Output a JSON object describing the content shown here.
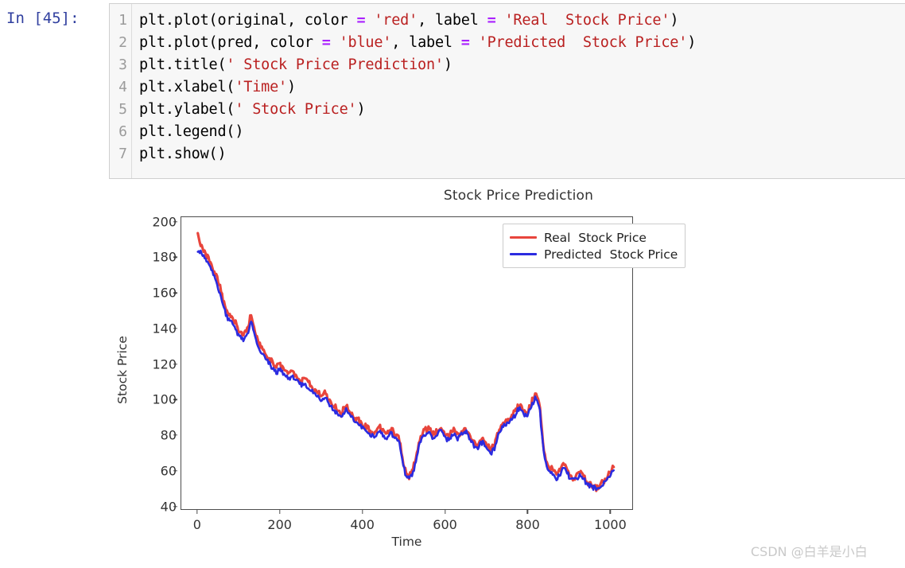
{
  "notebook": {
    "prompt": "In [45]:",
    "line_numbers": [
      "1",
      "2",
      "3",
      "4",
      "5",
      "6",
      "7"
    ],
    "code_lines": [
      [
        {
          "t": "plt.plot(original, color ",
          "c": "plain"
        },
        {
          "t": "=",
          "c": "op"
        },
        {
          "t": " ",
          "c": "plain"
        },
        {
          "t": "'red'",
          "c": "str"
        },
        {
          "t": ", label ",
          "c": "plain"
        },
        {
          "t": "=",
          "c": "op"
        },
        {
          "t": " ",
          "c": "plain"
        },
        {
          "t": "'Real  Stock Price'",
          "c": "str"
        },
        {
          "t": ")",
          "c": "plain"
        }
      ],
      [
        {
          "t": "plt.plot(pred, color ",
          "c": "plain"
        },
        {
          "t": "=",
          "c": "op"
        },
        {
          "t": " ",
          "c": "plain"
        },
        {
          "t": "'blue'",
          "c": "str"
        },
        {
          "t": ", label ",
          "c": "plain"
        },
        {
          "t": "=",
          "c": "op"
        },
        {
          "t": " ",
          "c": "plain"
        },
        {
          "t": "'Predicted  Stock Price'",
          "c": "str"
        },
        {
          "t": ")",
          "c": "plain"
        }
      ],
      [
        {
          "t": "plt.title(",
          "c": "plain"
        },
        {
          "t": "' Stock Price Prediction'",
          "c": "str"
        },
        {
          "t": ")",
          "c": "plain"
        }
      ],
      [
        {
          "t": "plt.xlabel(",
          "c": "plain"
        },
        {
          "t": "'Time'",
          "c": "str"
        },
        {
          "t": ")",
          "c": "plain"
        }
      ],
      [
        {
          "t": "plt.ylabel(",
          "c": "plain"
        },
        {
          "t": "' Stock Price'",
          "c": "str"
        },
        {
          "t": ")",
          "c": "plain"
        }
      ],
      [
        {
          "t": "plt.legend()",
          "c": "plain"
        }
      ],
      [
        {
          "t": "plt.show()",
          "c": "plain"
        }
      ]
    ]
  },
  "watermark": "CSDN @白羊是小白",
  "colors": {
    "real": "#E8453C",
    "predicted": "#2B2BE0",
    "axis": "#4d4d4d",
    "text": "#333333",
    "prompt": "#303F9F",
    "string": "#BA2121",
    "operator": "#AA22FF"
  },
  "chart_data": {
    "type": "line",
    "title": "Stock Price Prediction",
    "xlabel": "Time",
    "ylabel": "Stock Price",
    "xlim": [
      -40,
      1055
    ],
    "ylim": [
      38,
      203
    ],
    "xticks": [
      0,
      200,
      400,
      600,
      800,
      1000
    ],
    "yticks": [
      40,
      60,
      80,
      100,
      120,
      140,
      160,
      180,
      200
    ],
    "grid": false,
    "legend_position": "upper right",
    "series": [
      {
        "name": "Real  Stock Price",
        "color": "#E8453C",
        "x": [
          0,
          10,
          20,
          30,
          40,
          50,
          60,
          70,
          80,
          90,
          100,
          110,
          120,
          130,
          140,
          150,
          160,
          170,
          180,
          190,
          200,
          210,
          220,
          230,
          240,
          250,
          260,
          270,
          280,
          290,
          300,
          310,
          320,
          330,
          340,
          350,
          360,
          370,
          380,
          390,
          400,
          410,
          420,
          430,
          440,
          450,
          460,
          470,
          480,
          490,
          500,
          510,
          520,
          530,
          540,
          550,
          560,
          570,
          580,
          590,
          600,
          610,
          620,
          630,
          640,
          650,
          660,
          670,
          680,
          690,
          700,
          710,
          720,
          730,
          740,
          750,
          760,
          770,
          780,
          790,
          800,
          810,
          820,
          830,
          840,
          850,
          860,
          870,
          880,
          890,
          900,
          910,
          920,
          930,
          940,
          950,
          960,
          970,
          980,
          990,
          1000,
          1010
        ],
        "y": [
          193,
          185,
          182,
          178,
          172,
          166,
          158,
          150,
          147,
          144,
          139,
          136,
          140,
          148,
          137,
          131,
          128,
          124,
          121,
          118,
          120,
          117,
          114,
          116,
          113,
          110,
          112,
          109,
          106,
          104,
          102,
          104,
          99,
          96,
          94,
          92,
          97,
          93,
          90,
          88,
          86,
          84,
          82,
          80,
          85,
          82,
          80,
          83,
          80,
          78,
          63,
          56,
          58,
          67,
          78,
          82,
          84,
          80,
          82,
          85,
          81,
          79,
          83,
          80,
          82,
          84,
          80,
          76,
          74,
          78,
          75,
          71,
          74,
          82,
          86,
          88,
          90,
          93,
          97,
          95,
          92,
          98,
          104,
          97,
          72,
          62,
          60,
          57,
          59,
          65,
          59,
          55,
          57,
          59,
          55,
          52,
          51,
          50,
          52,
          55,
          58,
          62
        ]
      },
      {
        "name": "Predicted  Stock Price",
        "color": "#2B2BE0",
        "x": [
          0,
          10,
          20,
          30,
          40,
          50,
          60,
          70,
          80,
          90,
          100,
          110,
          120,
          130,
          140,
          150,
          160,
          170,
          180,
          190,
          200,
          210,
          220,
          230,
          240,
          250,
          260,
          270,
          280,
          290,
          300,
          310,
          320,
          330,
          340,
          350,
          360,
          370,
          380,
          390,
          400,
          410,
          420,
          430,
          440,
          450,
          460,
          470,
          480,
          490,
          500,
          510,
          520,
          530,
          540,
          550,
          560,
          570,
          580,
          590,
          600,
          610,
          620,
          630,
          640,
          650,
          660,
          670,
          680,
          690,
          700,
          710,
          720,
          730,
          740,
          750,
          760,
          770,
          780,
          790,
          800,
          810,
          820,
          830,
          840,
          850,
          860,
          870,
          880,
          890,
          900,
          910,
          920,
          930,
          940,
          950,
          960,
          970,
          980,
          990,
          1000,
          1010
        ],
        "y": [
          184,
          182,
          179,
          175,
          169,
          163,
          155,
          147,
          144,
          141,
          136,
          133,
          137,
          144,
          134,
          128,
          125,
          121,
          118,
          115,
          117,
          114,
          112,
          113,
          110,
          108,
          109,
          106,
          104,
          102,
          100,
          101,
          97,
          94,
          92,
          90,
          94,
          91,
          88,
          86,
          84,
          82,
          80,
          78,
          83,
          80,
          78,
          81,
          78,
          76,
          61,
          55,
          57,
          65,
          76,
          80,
          82,
          78,
          80,
          83,
          79,
          77,
          81,
          78,
          80,
          82,
          78,
          74,
          72,
          76,
          73,
          69,
          72,
          80,
          84,
          86,
          88,
          91,
          95,
          93,
          90,
          96,
          101,
          95,
          70,
          60,
          58,
          55,
          57,
          63,
          57,
          54,
          56,
          57,
          54,
          51,
          50,
          49,
          51,
          54,
          56,
          60
        ]
      }
    ]
  }
}
